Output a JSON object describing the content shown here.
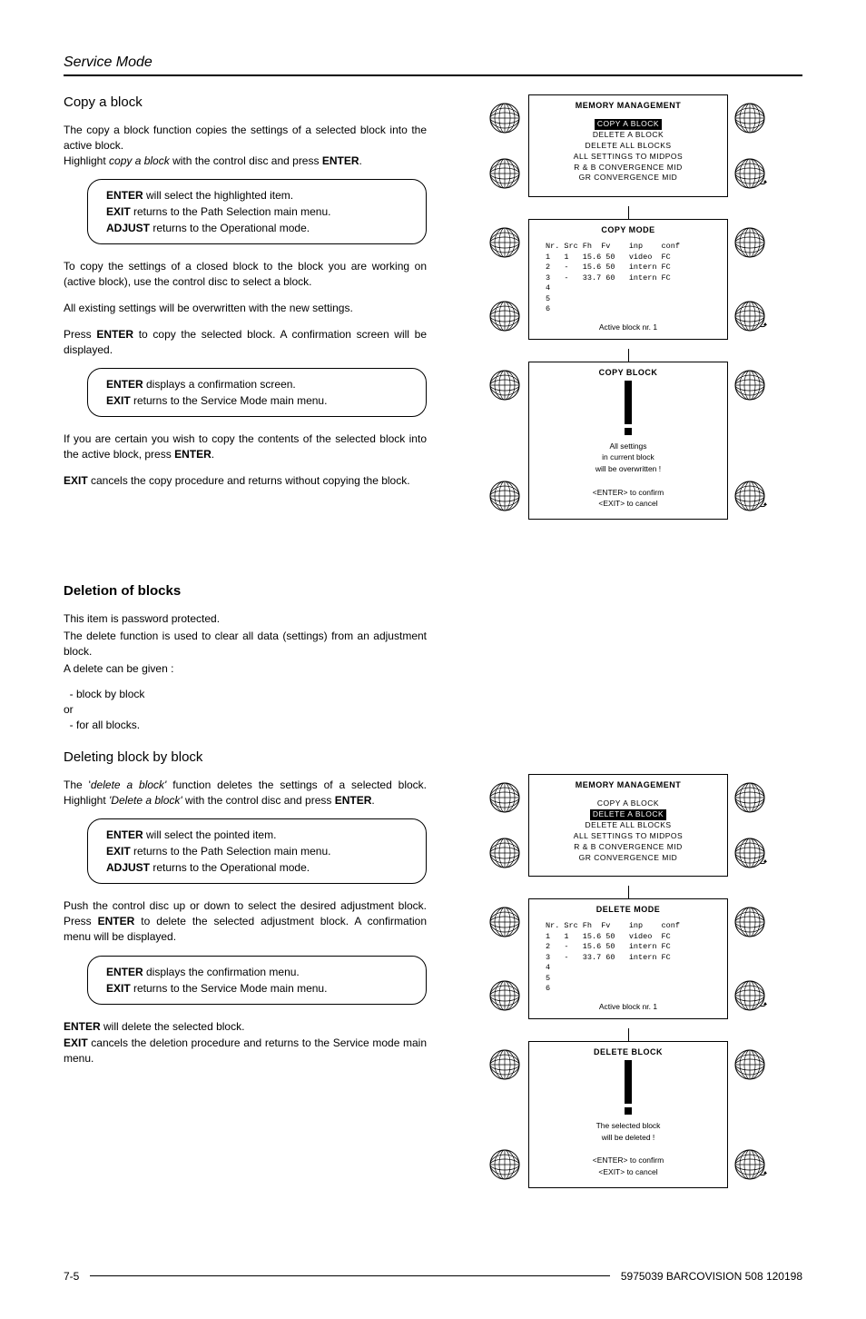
{
  "header": "Service Mode",
  "copy": {
    "heading": "Copy a block",
    "p1a": "The copy a block function copies the settings of a selected block into the active block.",
    "p1b_pre": "Highlight ",
    "p1b_i": "copy a block",
    "p1b_mid": " with the control disc and press ",
    "p1b_b": "ENTER",
    "p1b_post": ".",
    "co1_l1b": "ENTER",
    "co1_l1": " will select the highlighted item.",
    "co1_l2b": "EXIT",
    "co1_l2": " returns to the Path Selection  main menu.",
    "co1_l3b": "ADJUST",
    "co1_l3": " returns to the Operational mode.",
    "p2": "To copy the settings of a closed block to the block you are working on (active block), use the control disc to select a block.",
    "p3": "All existing settings will be overwritten with the new settings.",
    "p4_pre": "Press ",
    "p4_b": "ENTER",
    "p4_post": " to copy the selected block.  A confirmation screen will be displayed.",
    "co2_l1b": "ENTER",
    "co2_l1": " displays a confirmation screen.",
    "co2_l2b": "EXIT",
    "co2_l2": " returns to the Service Mode main menu.",
    "p5_pre": "If you are certain you wish to copy the contents  of the selected block into the active block, press ",
    "p5_b": "ENTER",
    "p5_post": ".",
    "p6_b": "EXIT",
    "p6": " cancels the copy procedure and returns without copying the block."
  },
  "del": {
    "heading": "Deletion of blocks",
    "p1": "This item is password protected.",
    "p2": "The delete function is used to clear all data (settings) from an adjustment block.",
    "p3": "A delete can be given :",
    "bul1": "  - block by block",
    "or": "or",
    "bul2": "  - for all blocks.",
    "sub": "Deleting block by block",
    "p4_pre": "The '",
    "p4_i": "delete a block'",
    "p4_post": " function deletes the settings of a selected block.",
    "p5_pre": "Highlight ",
    "p5_i": "'Delete a block'",
    "p5_mid": " with the control disc and press ",
    "p5_b": "ENTER",
    "p5_post": ".",
    "co1_l1b": "ENTER",
    "co1_l1": " will select the pointed item.",
    "co1_l2b": "EXIT",
    "co1_l2": " returns to the Path Selection main menu.",
    "co1_l3b": "ADJUST",
    "co1_l3": " returns to the Operational mode.",
    "p6_pre": "Push the control disc up or down to select the desired adjustment block.   Press ",
    "p6_b": "ENTER",
    "p6_post": " to delete the selected adjustment block.  A confirmation menu will be displayed.",
    "co2_l1b": "ENTER",
    "co2_l1": " displays the confirmation menu.",
    "co2_l2b": "EXIT",
    "co2_l2": " returns to the Service Mode main menu.",
    "p7_b": "ENTER",
    "p7": " will delete the selected block.",
    "p8_b": "EXIT",
    "p8": " cancels the deletion procedure and returns to the Service mode main menu."
  },
  "diag1": {
    "mm_title": "MEMORY MANAGEMENT",
    "mm_hl": "COPY A BLOCK",
    "mm_i2": "DELETE A BLOCK",
    "mm_i3": "DELETE ALL BLOCKS",
    "mm_i4": "ALL SETTINGS TO MIDPOS",
    "mm_i5": "R & B CONVERGENCE MID",
    "mm_i6": "GR CONVERGENCE MID",
    "mode_title": "COPY MODE",
    "tbl_head": "Nr. Src Fh  Fv    inp    conf",
    "tbl_r1": "1   1   15.6 50   video  FC",
    "tbl_r2": "2   -   15.6 50   intern FC",
    "tbl_r3": "3   -   33.7 60   intern FC",
    "tbl_r4": "4",
    "tbl_r5": "5",
    "tbl_r6": "6",
    "active": "Active block nr.  1",
    "warn_title": "COPY BLOCK",
    "warn_l1": "All settings",
    "warn_l2": "in current block",
    "warn_l3": "will be overwritten !",
    "warn_l4": "<ENTER> to confirm",
    "warn_l5": "<EXIT> to cancel"
  },
  "diag2": {
    "mm_title": "MEMORY MANAGEMENT",
    "mm_i1": "COPY A BLOCK",
    "mm_hl": "DELETE A BLOCK",
    "mm_i3": "DELETE ALL BLOCKS",
    "mm_i4": "ALL SETTINGS TO MIDPOS",
    "mm_i5": "R & B CONVERGENCE MID",
    "mm_i6": "GR CONVERGENCE MID",
    "mode_title": "DELETE MODE",
    "tbl_head": "Nr. Src Fh  Fv    inp    conf",
    "tbl_r1": "1   1   15.6 50   video  FC",
    "tbl_r2": "2   -   15.6 50   intern FC",
    "tbl_r3": "3   -   33.7 60   intern FC",
    "tbl_r4": "4",
    "tbl_r5": "5",
    "tbl_r6": "6",
    "active": "Active block nr.  1",
    "warn_title": "DELETE BLOCK",
    "warn_l1": "The selected block",
    "warn_l2": "will be deleted !",
    "warn_l4": "<ENTER> to confirm",
    "warn_l5": "<EXIT> to cancel"
  },
  "footer": {
    "left": "7-5",
    "right": "5975039 BARCOVISION 508 120198"
  }
}
